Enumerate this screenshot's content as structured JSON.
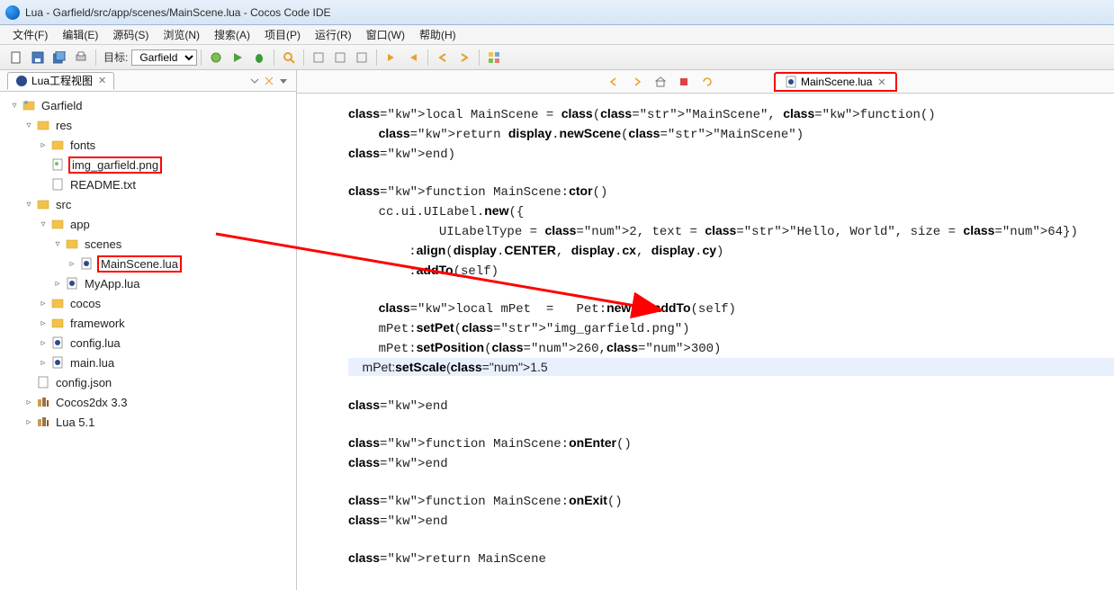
{
  "title": "Lua - Garfield/src/app/scenes/MainScene.lua - Cocos Code IDE",
  "menu": [
    "文件(F)",
    "编辑(E)",
    "源码(S)",
    "浏览(N)",
    "搜索(A)",
    "项目(P)",
    "运行(R)",
    "窗口(W)",
    "帮助(H)"
  ],
  "toolbar": {
    "target_label": "目标:",
    "target_value": "Garfield"
  },
  "project_view": {
    "title": "Lua工程视图"
  },
  "tree": {
    "root": "Garfield",
    "res": "res",
    "fonts": "fonts",
    "img": "img_garfield.png",
    "readme": "README.txt",
    "src": "src",
    "app": "app",
    "scenes": "scenes",
    "mainscene": "MainScene.lua",
    "myapp": "MyApp.lua",
    "cocos": "cocos",
    "framework": "framework",
    "configlua": "config.lua",
    "mainlua": "main.lua",
    "configjson": "config.json",
    "cocos2dx": "Cocos2dx 3.3",
    "lua51": "Lua 5.1"
  },
  "editor_tab": "MainScene.lua",
  "code_lines": [
    "local MainScene = class(\"MainScene\", function()",
    "    return display.newScene(\"MainScene\")",
    "end)",
    "",
    "function MainScene:ctor()",
    "    cc.ui.UILabel.new({",
    "            UILabelType = 2, text = \"Hello, World\", size = 64})",
    "        :align(display.CENTER, display.cx, display.cy)",
    "        :addTo(self)",
    "",
    "    local mPet  =   Pet:new():addTo(self)",
    "    mPet:setPet(\"img_garfield.png\")",
    "    mPet:setPosition(260,300)",
    "    mPet:setScale(1.5)",
    "",
    "end",
    "",
    "function MainScene:onEnter()",
    "end",
    "",
    "function MainScene:onExit()",
    "end",
    "",
    "return MainScene"
  ]
}
